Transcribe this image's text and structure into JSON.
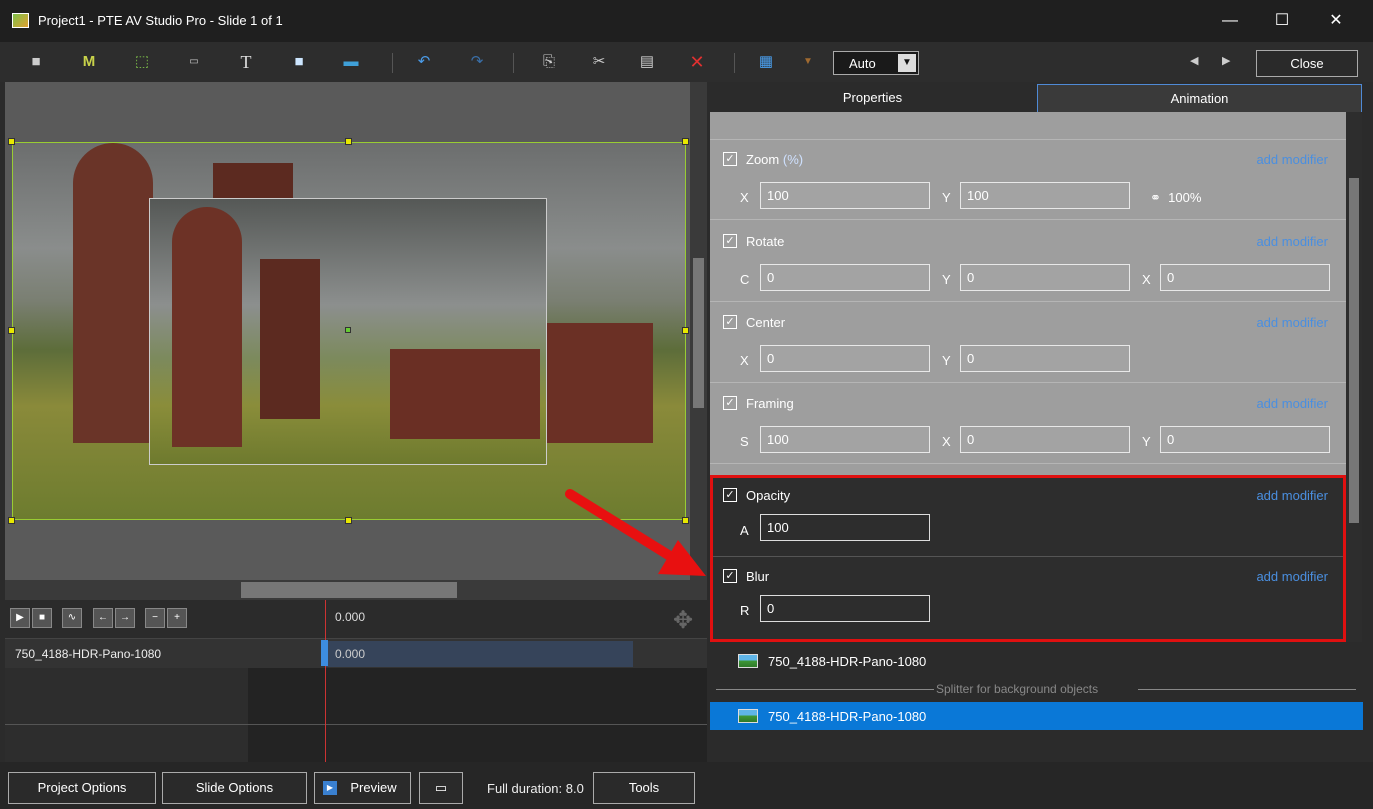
{
  "window": {
    "title": "Project1 - PTE AV Studio Pro - Slide 1 of 1",
    "minimize": "—",
    "maximize": "☐",
    "close": "✕"
  },
  "toolbar": {
    "zoom_mode": "Auto",
    "close_label": "Close",
    "icons": [
      "camera-icon",
      "mask-icon",
      "frame-icon",
      "button-icon",
      "text-icon",
      "rectangle-icon",
      "image-icon",
      "undo-icon",
      "redo-icon",
      "copy-icon",
      "cut-icon",
      "paste-icon",
      "delete-icon",
      "grid-icon"
    ]
  },
  "tabs": {
    "properties": "Properties",
    "animation": "Animation"
  },
  "props": {
    "zoom": {
      "label": "Zoom",
      "unit": "(%)",
      "x_axis": "X",
      "x": "100",
      "y_axis": "Y",
      "y": "100",
      "link_value": "100%"
    },
    "rotate": {
      "label": "Rotate",
      "c_axis": "C",
      "c": "0",
      "y_axis": "Y",
      "y": "0",
      "x_axis": "X",
      "x": "0"
    },
    "center": {
      "label": "Center",
      "x_axis": "X",
      "x": "0",
      "y_axis": "Y",
      "y": "0"
    },
    "framing": {
      "label": "Framing",
      "s_axis": "S",
      "s": "100",
      "x_axis": "X",
      "x": "0",
      "y_axis": "Y",
      "y": "0"
    },
    "opacity": {
      "label": "Opacity",
      "a_axis": "A",
      "a": "100"
    },
    "blur": {
      "label": "Blur",
      "r_axis": "R",
      "r": "0"
    },
    "add_modifier": "add modifier",
    "check": "✓"
  },
  "objects": {
    "item1": "750_4188-HDR-Pano-1080",
    "splitter": "Splitter for background objects",
    "item2": "750_4188-HDR-Pano-1080"
  },
  "timeline": {
    "time": "0.000",
    "track_name": "750_4188-HDR-Pano-1080",
    "clip_time": "0.000"
  },
  "bottom": {
    "project_options": "Project Options",
    "slide_options": "Slide Options",
    "preview": "Preview",
    "duration": "Full duration: 8.0",
    "tools": "Tools"
  },
  "colors": {
    "accent": "#0a78d7",
    "highlight": "#e01010",
    "link": "#4a8fe0"
  }
}
